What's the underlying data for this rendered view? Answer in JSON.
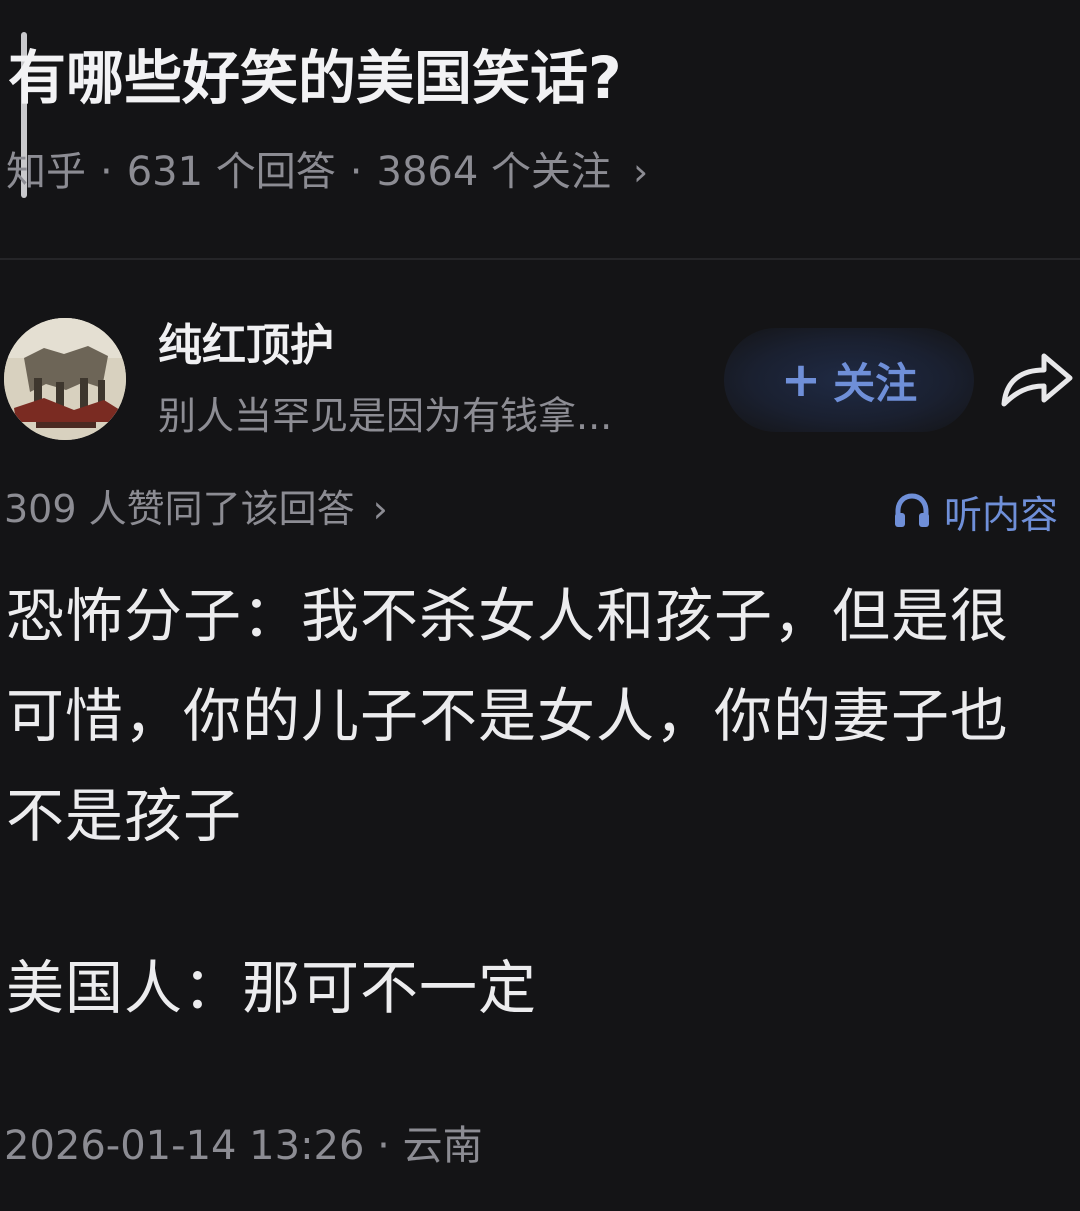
{
  "question": {
    "title": "有哪些好笑的美国笑话?",
    "source": "知乎",
    "answers": "631 个回答",
    "followers": "3864 个关注",
    "separator": "·",
    "chevron": "›"
  },
  "author": {
    "name": "纯红顶护",
    "bio": "别人当罕见是因为有钱拿...",
    "follow_label": "关注",
    "follow_plus": "+"
  },
  "answer": {
    "upvotes_text": "309 人赞同了该回答",
    "chevron": "›",
    "listen_label": "听内容",
    "paragraph1": "恐怖分子：我不杀女人和孩子，但是很可惜，你的儿子不是女人，你的妻子也不是孩子",
    "paragraph2": "美国人：那可不一定",
    "footer": "2026-01-14 13:26 · 云南"
  },
  "icons": {
    "share": "share-arrow-icon",
    "listen": "headphones-icon"
  },
  "colors": {
    "background": "#141416",
    "accent": "#6f8fd8",
    "muted": "#8c8c93"
  }
}
